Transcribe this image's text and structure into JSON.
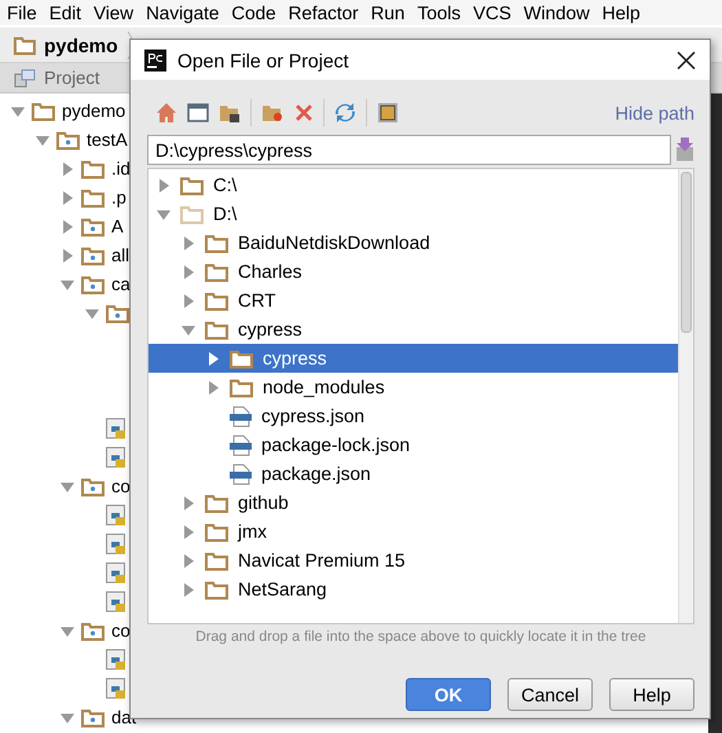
{
  "menu": [
    "File",
    "Edit",
    "View",
    "Navigate",
    "Code",
    "Refactor",
    "Run",
    "Tools",
    "VCS",
    "Window",
    "Help"
  ],
  "breadcrumb": {
    "project": "pydemo"
  },
  "tool_window": {
    "title": "Project"
  },
  "project_tree": [
    {
      "kind": "folder",
      "label": "pydemo",
      "expanded": true,
      "children": [
        {
          "kind": "module",
          "label": "testA",
          "expanded": true,
          "children": [
            {
              "kind": "folder",
              "label": ".id",
              "expanded": false
            },
            {
              "kind": "folder",
              "label": ".p",
              "expanded": false
            },
            {
              "kind": "module",
              "label": "A",
              "expanded": false
            },
            {
              "kind": "module",
              "label": "all",
              "expanded": false
            },
            {
              "kind": "module",
              "label": "ca",
              "expanded": true,
              "children": [
                {
                  "kind": "module",
                  "expanded": true
                },
                {
                  "kind": "python"
                },
                {
                  "kind": "python"
                }
              ]
            },
            {
              "kind": "module",
              "label": "co",
              "expanded": true,
              "children": [
                {
                  "kind": "python"
                },
                {
                  "kind": "python"
                },
                {
                  "kind": "python"
                },
                {
                  "kind": "python"
                }
              ]
            },
            {
              "kind": "module",
              "label": "co",
              "expanded": true,
              "children": [
                {
                  "kind": "python"
                },
                {
                  "kind": "python"
                }
              ]
            },
            {
              "kind": "module",
              "label": "dat",
              "expanded": true
            }
          ]
        }
      ]
    }
  ],
  "dialog": {
    "title": "Open File or Project",
    "hide_path": "Hide path",
    "path": "D:\\cypress\\cypress",
    "tree": [
      {
        "kind": "folder",
        "label": "C:\\",
        "expanded": false,
        "selected": false
      },
      {
        "kind": "drive",
        "label": "D:\\",
        "expanded": true,
        "selected": false,
        "children": [
          {
            "kind": "folder",
            "label": "BaiduNetdiskDownload",
            "expanded": false,
            "selected": false
          },
          {
            "kind": "folder",
            "label": "Charles",
            "expanded": false,
            "selected": false
          },
          {
            "kind": "folder",
            "label": "CRT",
            "expanded": false,
            "selected": false
          },
          {
            "kind": "folder",
            "label": "cypress",
            "expanded": true,
            "selected": false,
            "children": [
              {
                "kind": "folder",
                "label": "cypress",
                "expanded": false,
                "selected": true
              },
              {
                "kind": "folder",
                "label": "node_modules",
                "expanded": false,
                "selected": false
              },
              {
                "kind": "json",
                "label": "cypress.json",
                "selected": false
              },
              {
                "kind": "json",
                "label": "package-lock.json",
                "selected": false
              },
              {
                "kind": "json",
                "label": "package.json",
                "selected": false
              }
            ]
          },
          {
            "kind": "folder",
            "label": "github",
            "expanded": false,
            "selected": false
          },
          {
            "kind": "folder",
            "label": "jmx",
            "expanded": false,
            "selected": false
          },
          {
            "kind": "folder",
            "label": "Navicat Premium 15",
            "expanded": false,
            "selected": false
          },
          {
            "kind": "folder",
            "label": "NetSarang",
            "expanded": false,
            "selected": false
          }
        ]
      }
    ],
    "hint": "Drag and drop a file into the space above to quickly locate it in the tree",
    "buttons": [
      {
        "label": "OK",
        "kind": "primary"
      },
      {
        "label": "Cancel",
        "kind": "normal"
      },
      {
        "label": "Help",
        "kind": "normal"
      }
    ]
  }
}
